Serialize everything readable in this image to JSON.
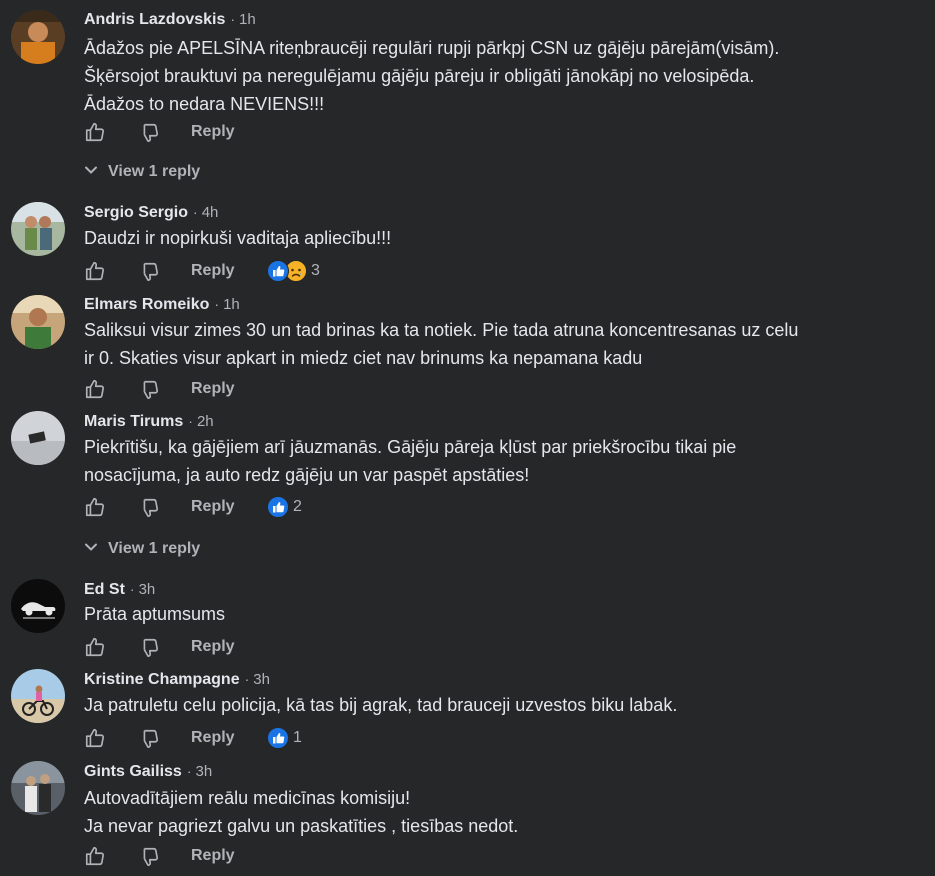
{
  "actions": {
    "reply_label": "Reply"
  },
  "comments": [
    {
      "author": "Andris Lazdovskis",
      "time": "1h",
      "lines": [
        "Ādažos pie APELSĪNA riteņbraucēji regulāri rupji pārkpj CSN uz gājēju pārejām(visām).",
        "Šķērsojot brauktuvi pa neregulējamu gājēju pāreju ir obligāti jānokāpj no velosipēda.",
        "Ādažos to nedara NEVIENS!!!"
      ],
      "view_replies": "View 1 reply"
    },
    {
      "author": "Sergio Sergio",
      "time": "4h",
      "lines": [
        "Daudzi ir nopirkuši vaditaja apliecību!!!"
      ],
      "reactions": {
        "types": [
          "like-icon",
          "sad-icon"
        ],
        "count": "3"
      }
    },
    {
      "author": "Elmars Romeiko",
      "time": "1h",
      "lines": [
        "Saliksui visur zimes 30 un tad brinas ka ta notiek. Pie tada atruna koncentresanas uz celu",
        "ir 0. Skaties visur apkart in miedz ciet nav brinums ka nepamana kadu"
      ]
    },
    {
      "author": "Maris Tirums",
      "time": "2h",
      "lines": [
        "Piekrītišu, ka gājējiem arī jāuzmanās. Gājēju pāreja kļūst par priekšrocību tikai pie",
        "nosacījuma, ja auto redz gājēju un var paspēt apstāties!"
      ],
      "reactions": {
        "types": [
          "like-icon"
        ],
        "count": "2"
      },
      "view_replies": "View 1 reply"
    },
    {
      "author": "Ed St",
      "time": "3h",
      "lines": [
        "Prāta aptumsums"
      ]
    },
    {
      "author": "Kristine Champagne",
      "time": "3h",
      "lines": [
        "Ja patruletu celu policija, kā tas bij agrak, tad brauceji uzvestos biku labak."
      ],
      "reactions": {
        "types": [
          "like-icon"
        ],
        "count": "1"
      }
    },
    {
      "author": "Gints Gailiss",
      "time": "3h",
      "lines": [
        "Autovadītājiem reālu medicīnas komisiju!",
        "Ja nevar pagriezt galvu un paskatīties , tiesības nedot."
      ]
    }
  ],
  "colors": {
    "background": "#252728",
    "text_primary": "#e4e6eb",
    "text_secondary": "#b0b3b8",
    "like_blue": "#1b74e4",
    "sad_yellow": "#f7b125"
  }
}
